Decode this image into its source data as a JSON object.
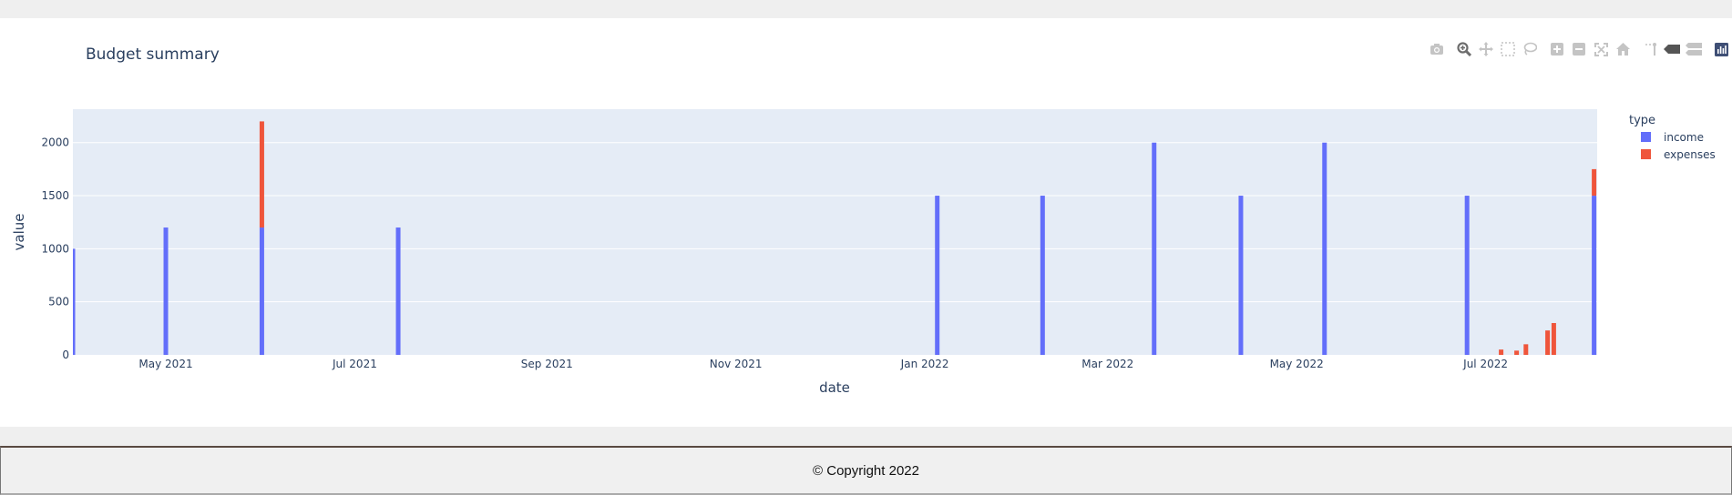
{
  "page": {
    "footer_text": "© Copyright 2022"
  },
  "modebar": {
    "buttons": [
      {
        "name": "camera-icon",
        "title": "Download plot as a png"
      },
      {
        "name": "zoom-icon",
        "title": "Zoom"
      },
      {
        "name": "pan-icon",
        "title": "Pan"
      },
      {
        "name": "box-select-icon",
        "title": "Box Select"
      },
      {
        "name": "lasso-select-icon",
        "title": "Lasso Select"
      },
      {
        "name": "zoom-in-icon",
        "title": "Zoom in"
      },
      {
        "name": "zoom-out-icon",
        "title": "Zoom out"
      },
      {
        "name": "autoscale-icon",
        "title": "Autoscale"
      },
      {
        "name": "reset-axes-icon",
        "title": "Reset axes"
      },
      {
        "name": "spike-lines-icon",
        "title": "Toggle Spike Lines"
      },
      {
        "name": "hover-closest-icon",
        "title": "Show closest data on hover"
      },
      {
        "name": "hover-compare-icon",
        "title": "Compare data on hover"
      },
      {
        "name": "plotly-logo-icon",
        "title": "Produced with Plotly"
      }
    ]
  },
  "colors": {
    "income": "#636efa",
    "expenses": "#ef553b",
    "plot_bg": "#e5ecf6",
    "text": "#2a3f5f",
    "grid": "#ffffff"
  },
  "chart_data": {
    "type": "bar",
    "barmode": "stack",
    "title": "Budget summary",
    "xlabel": "date",
    "ylabel": "value",
    "x_range": [
      "2021-04-01",
      "2022-08-06"
    ],
    "ylim": [
      0,
      2315
    ],
    "y_ticks": [
      0,
      500,
      1000,
      1500,
      2000
    ],
    "x_ticks": [
      {
        "date": "2021-05-01",
        "label": "May 2021"
      },
      {
        "date": "2021-07-01",
        "label": "Jul 2021"
      },
      {
        "date": "2021-09-01",
        "label": "Sep 2021"
      },
      {
        "date": "2021-11-01",
        "label": "Nov 2021"
      },
      {
        "date": "2022-01-01",
        "label": "Jan 2022"
      },
      {
        "date": "2022-03-01",
        "label": "Mar 2022"
      },
      {
        "date": "2022-05-01",
        "label": "May 2022"
      },
      {
        "date": "2022-07-01",
        "label": "Jul 2022"
      }
    ],
    "legend": {
      "title": "type",
      "position": "right"
    },
    "grid": true,
    "series": [
      {
        "name": "income",
        "points": [
          {
            "x": "2021-04-01",
            "y": 1000
          },
          {
            "x": "2021-05-01",
            "y": 1200
          },
          {
            "x": "2021-06-01",
            "y": 1200
          },
          {
            "x": "2021-07-15",
            "y": 1200
          },
          {
            "x": "2022-01-05",
            "y": 1500
          },
          {
            "x": "2022-02-08",
            "y": 1500
          },
          {
            "x": "2022-03-16",
            "y": 2000
          },
          {
            "x": "2022-04-13",
            "y": 1500
          },
          {
            "x": "2022-05-10",
            "y": 2000
          },
          {
            "x": "2022-06-25",
            "y": 1500
          },
          {
            "x": "2022-08-05",
            "y": 1500
          }
        ]
      },
      {
        "name": "expenses",
        "points": [
          {
            "x": "2021-06-01",
            "y": 1000
          },
          {
            "x": "2022-07-06",
            "y": 50
          },
          {
            "x": "2022-07-11",
            "y": 40
          },
          {
            "x": "2022-07-14",
            "y": 100
          },
          {
            "x": "2022-07-21",
            "y": 230
          },
          {
            "x": "2022-07-23",
            "y": 300
          },
          {
            "x": "2022-08-05",
            "y": 250
          }
        ]
      }
    ]
  }
}
